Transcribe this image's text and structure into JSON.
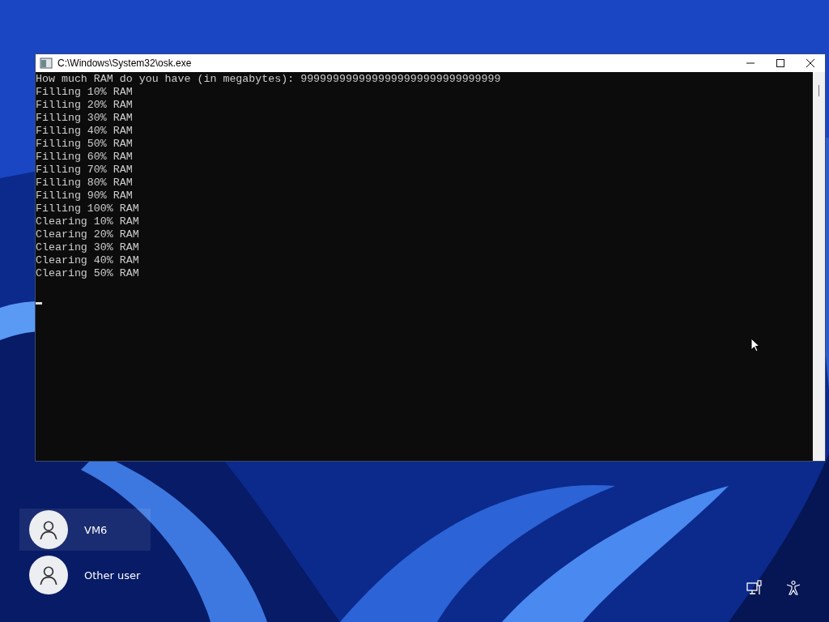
{
  "window": {
    "title": "C:\\Windows\\System32\\osk.exe"
  },
  "console": {
    "lines": [
      "How much RAM do you have (in megabytes): 9999999999999999999999999999999",
      "Filling 10% RAM",
      "Filling 20% RAM",
      "Filling 30% RAM",
      "Filling 40% RAM",
      "Filling 50% RAM",
      "Filling 60% RAM",
      "Filling 70% RAM",
      "Filling 80% RAM",
      "Filling 90% RAM",
      "Filling 100% RAM",
      "Clearing 10% RAM",
      "Clearing 20% RAM",
      "Clearing 30% RAM",
      "Clearing 40% RAM",
      "Clearing 50% RAM"
    ]
  },
  "users": [
    {
      "name": "VM6",
      "selected": true
    },
    {
      "name": "Other user",
      "selected": false
    }
  ]
}
